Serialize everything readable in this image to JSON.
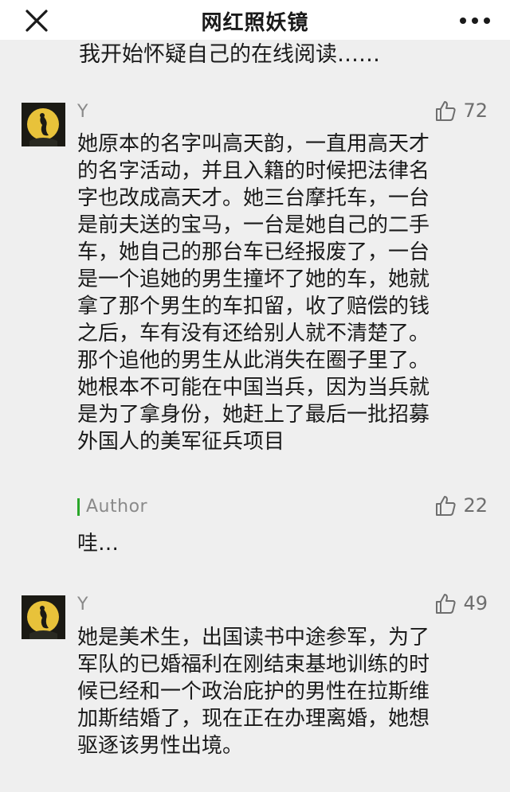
{
  "header": {
    "title": "网红照妖镜",
    "close_icon": "close-icon",
    "more_icon": "more-icon"
  },
  "cutoff_text": "我开始怀疑自己的在线阅读……",
  "comments": [
    {
      "username": "Y",
      "likes": "72",
      "text": "她原本的名字叫高天韵，一直用高天才\n的名字活动，并且入籍的时候把法律名\n字也改成高天才。她三台摩托车，一台\n是前夫送的宝马，一台是她自己的二手\n车，她自己的那台车已经报废了，一台\n是一个追她的男生撞坏了她的车，她就\n拿了那个男生的车扣留，收了赔偿的钱\n之后，车有没有还给别人就不清楚了。\n那个追他的男生从此消失在圈子里了。\n她根本不可能在中国当兵，因为当兵就\n是为了拿身份，她赶上了最后一批招募\n外国人的美军征兵项目",
      "reply": {
        "label": "Author",
        "likes": "22",
        "text": "哇…"
      }
    },
    {
      "username": "Y",
      "likes": "49",
      "text": "她是美术生，出国读书中途参军，为了\n军队的已婚福利在刚结束基地训练的时\n候已经和一个政治庇护的男性在拉斯维\n加斯结婚了，现在正在办理离婚，她想\n驱逐该男性出境。"
    }
  ],
  "colors": {
    "background": "#efefef",
    "author_accent": "#2aa72a",
    "muted_text": "#8a8a8a"
  }
}
